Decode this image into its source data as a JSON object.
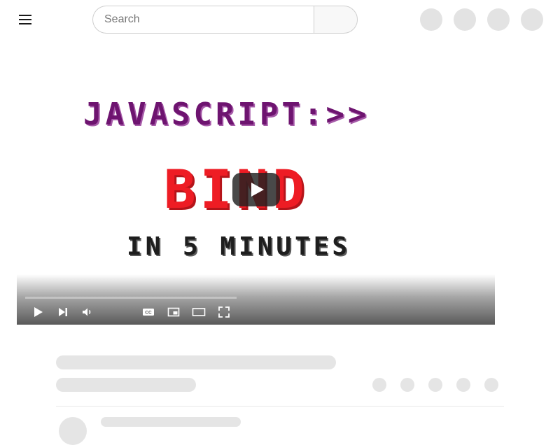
{
  "header": {
    "menu_icon": "hamburger-menu-icon",
    "search": {
      "placeholder": "Search",
      "value": "",
      "button_icon": "search-icon"
    },
    "action_icons": [
      "create-icon",
      "apps-icon",
      "notifications-icon",
      "avatar"
    ]
  },
  "video": {
    "thumbnail": {
      "line1": "JAVASCRIPT:>>",
      "line2": "BIND",
      "line3": "IN 5 MINUTES"
    },
    "colors": {
      "line1": "#6e1470",
      "line2": "#ee1c24",
      "line3": "#1e1e1e",
      "progress": "#ff0000"
    },
    "progress": 0,
    "controls": [
      "play-icon",
      "next-icon",
      "volume-icon",
      "captions-icon",
      "miniplayer-icon",
      "theater-mode-icon",
      "fullscreen-icon"
    ]
  },
  "placeholder_actions": 5
}
